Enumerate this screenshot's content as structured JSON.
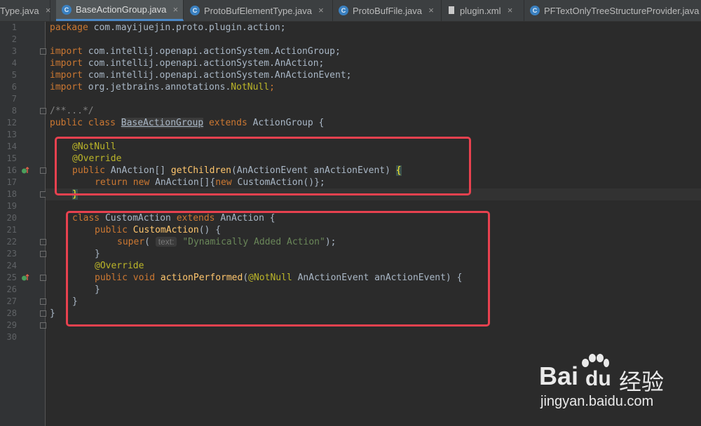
{
  "tabs": [
    {
      "label": "Type.java",
      "active": false,
      "icon": "none"
    },
    {
      "label": "BaseActionGroup.java",
      "active": true,
      "icon": "java-class-icon"
    },
    {
      "label": "ProtoBufElementType.java",
      "active": false,
      "icon": "java-class-icon"
    },
    {
      "label": "ProtoBufFile.java",
      "active": false,
      "icon": "java-class-icon"
    },
    {
      "label": "plugin.xml",
      "active": false,
      "icon": "xml-file-icon"
    },
    {
      "label": "PFTextOnlyTreeStructureProvider.java",
      "active": false,
      "icon": "java-class-icon"
    }
  ],
  "line_numbers": [
    "1",
    "2",
    "3",
    "4",
    "5",
    "6",
    "7",
    "8",
    "12",
    "13",
    "14",
    "15",
    "16",
    "17",
    "18",
    "19",
    "20",
    "21",
    "22",
    "23",
    "24",
    "25",
    "26",
    "27",
    "28",
    "29",
    "30"
  ],
  "code": {
    "package": [
      "package",
      " com.mayijuejin.proto.plugin.action;"
    ],
    "import1": [
      "import",
      " com.intellij.openapi.actionSystem.ActionGroup;"
    ],
    "import2": [
      "import",
      " com.intellij.openapi.actionSystem.AnAction;"
    ],
    "import3": [
      "import",
      " com.intellij.openapi.actionSystem.AnActionEvent;"
    ],
    "import4": [
      "import",
      " org.jetbrains.annotations.",
      "NotNull",
      ";"
    ],
    "doc": "/**...*/",
    "class_decl": [
      "public class ",
      "BaseActionGroup",
      " extends ",
      "ActionGroup {"
    ],
    "l15": "@NotNull",
    "l16": "@Override",
    "l17": [
      "public ",
      "AnAction[] ",
      "getChildren",
      "(AnActionEvent anActionEvent) ",
      "{"
    ],
    "l18": [
      "return new ",
      "AnAction[]{",
      "new ",
      "CustomAction()};"
    ],
    "l19": "}",
    "l21": [
      "class ",
      "CustomAction ",
      "extends ",
      "AnAction {"
    ],
    "l22": [
      "public ",
      "CustomAction",
      "() {"
    ],
    "l23": [
      "super",
      "(",
      "text:",
      "\"Dynamically Added Action\"",
      ");"
    ],
    "l24": "}",
    "l25": "@Override",
    "l26": [
      "public void ",
      "actionPerformed",
      "(",
      "@NotNull",
      " AnActionEvent anActionEvent) {"
    ],
    "l27": "}",
    "l28": "}",
    "l29": "}"
  },
  "watermark": {
    "brand": "Bai",
    "brand2": "du",
    "suffix": "经验",
    "url": "jingyan.baidu.com"
  },
  "colors": {
    "keyword": "#cc7832",
    "annotation": "#bbb529",
    "function": "#ffc66d",
    "string": "#6a8759",
    "highlight_box": "#e8414f"
  }
}
